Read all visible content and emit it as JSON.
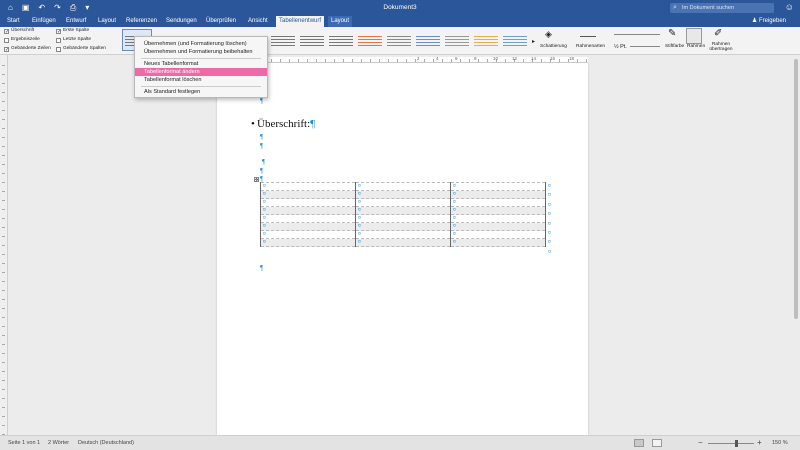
{
  "titlebar": {
    "document_title": "Dokument3",
    "search_placeholder": "Im Dokument suchen",
    "bg_color": "#2b579a"
  },
  "tabs": [
    {
      "label": "Start"
    },
    {
      "label": "Einfügen"
    },
    {
      "label": "Entwurf"
    },
    {
      "label": "Layout"
    },
    {
      "label": "Referenzen"
    },
    {
      "label": "Sendungen"
    },
    {
      "label": "Überprüfen"
    },
    {
      "label": "Ansicht"
    },
    {
      "label": "Tabellenentwurf",
      "active": true
    },
    {
      "label": "Layout"
    }
  ],
  "share_label": "Freigeben",
  "table_style_options": {
    "header_row": {
      "label": "Überschrift",
      "checked": true
    },
    "total_row": {
      "label": "Ergebniszeile",
      "checked": false
    },
    "banded_rows": {
      "label": "Gebänderte Zeilen",
      "checked": true
    },
    "first_column": {
      "label": "Erste Spalte",
      "checked": true
    },
    "last_column": {
      "label": "Letzte Spalte",
      "checked": false
    },
    "banded_columns": {
      "label": "Gebänderte Spalten",
      "checked": false
    }
  },
  "ribbon": {
    "shading_label": "Schattierung",
    "border_styles_label": "Rahmenarten",
    "pen_weight": "½ Pt.",
    "pen_color_label": "Stiftfarbe",
    "borders_label": "Rahmen",
    "border_painter_label": "Rahmen übertragen"
  },
  "dropdown_menu": {
    "items": [
      {
        "label": "Übernehmen (und Formatierung löschen)"
      },
      {
        "label": "Übernehmen und Formatierung beibehalten"
      },
      {
        "label": "Neues Tabellenformat"
      },
      {
        "label": "Tabellenformat ändern",
        "highlighted": true
      },
      {
        "label": "Tabellenformat löschen"
      },
      {
        "label": "Als Standard festlegen"
      }
    ],
    "highlight_color": "#ee6aa7"
  },
  "ruler_numbers": [
    "2",
    "4",
    "6",
    "8",
    "10",
    "12",
    "14",
    "16",
    "18"
  ],
  "document": {
    "heading": "Überschrift:",
    "pilcrow": "¶",
    "cell_marker": "¤",
    "table_rows": 8,
    "table_cols": 3
  },
  "status_bar": {
    "page": "Seite 1 von 1",
    "words": "2 Wörter",
    "language": "Deutsch (Deutschland)",
    "zoom": "150 %"
  }
}
